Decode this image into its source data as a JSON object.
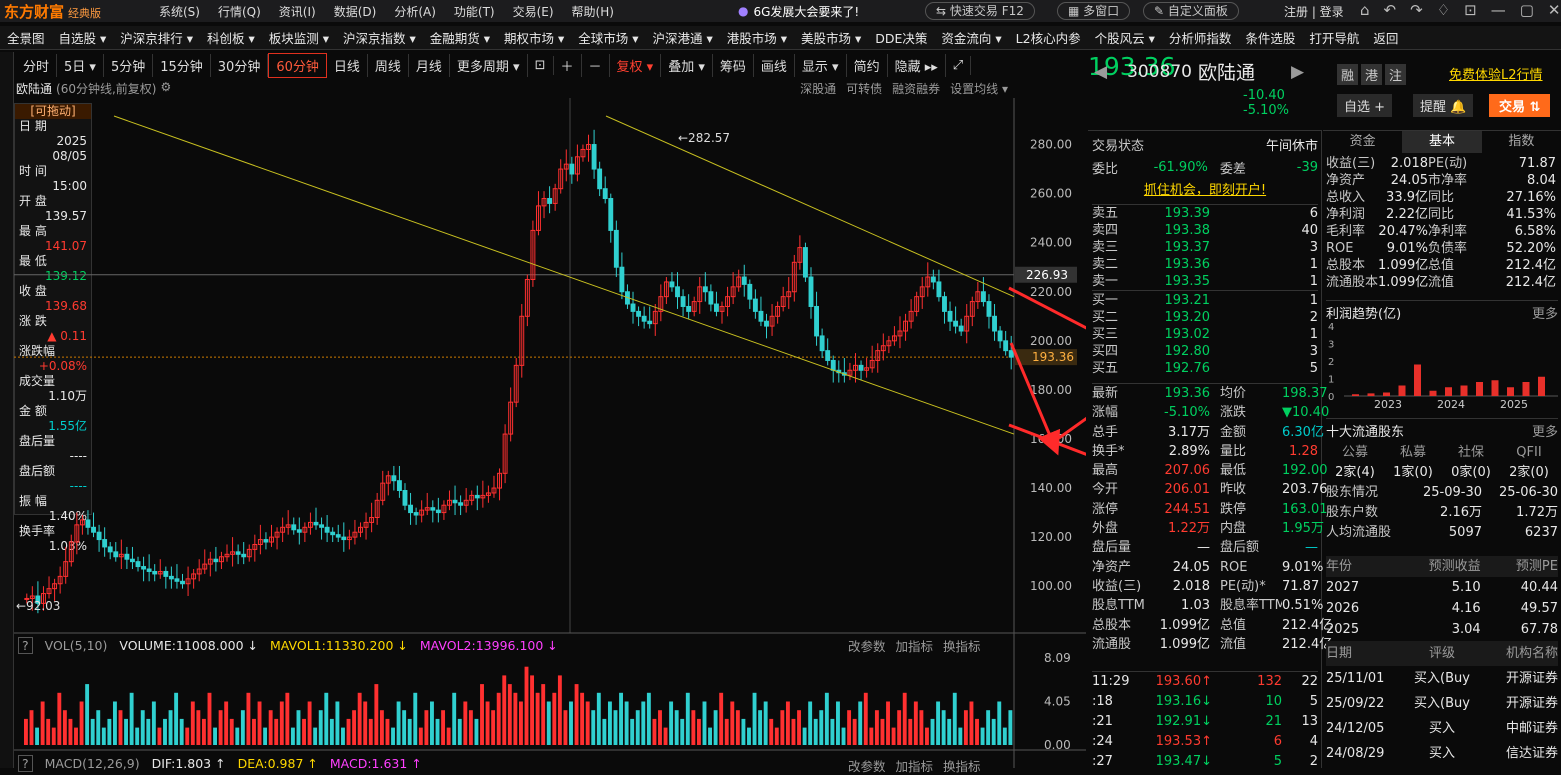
{
  "titlebar": {
    "logo": "东方财富",
    "edition": "经典版",
    "menus": [
      "系统(S)",
      "行情(Q)",
      "资讯(I)",
      "数据(D)",
      "分析(A)",
      "功能(T)",
      "交易(E)",
      "帮助(H)"
    ],
    "promo": "6G发展大会要来了!",
    "quick_trade": "快速交易 F12",
    "multi_window": "多窗口",
    "custom_panel": "自定义面板",
    "login": "注册 | 登录"
  },
  "navbar": [
    "全景图",
    "自选股 ▾",
    "沪深京排行 ▾",
    "科创板 ▾",
    "板块监测 ▾",
    "沪深京指数 ▾",
    "金融期货 ▾",
    "期权市场 ▾",
    "全球市场 ▾",
    "沪深港通 ▾",
    "港股市场 ▾",
    "美股市场 ▾",
    "DDE决策",
    "资金流向 ▾",
    "L2核心内参",
    "个股风云 ▾",
    "分析师指数",
    "条件选股",
    "打开导航",
    "返回"
  ],
  "toolbar": {
    "periods": [
      "分时",
      "5日 ▾",
      "5分钟",
      "15分钟",
      "30分钟",
      "60分钟",
      "日线",
      "周线",
      "月线",
      "更多周期 ▾"
    ],
    "selected": "60分钟",
    "adjust": "复权 ▾",
    "overlay": "叠加 ▾",
    "chips": "筹码",
    "draw": "画线",
    "display": "显示 ▾",
    "simple": "简约",
    "hide": "隐藏 ▸▸"
  },
  "subbar": {
    "title": "欧陆通",
    "info": "(60分钟线,前复权)",
    "links": [
      "深股通",
      "可转债",
      "融资融券",
      "设置均线 ▾"
    ]
  },
  "infobox": {
    "draggable": "[可拖动]",
    "date_label": "日 期",
    "date_year": "2025",
    "date_md": "08/05",
    "time_label": "时 间",
    "time": "15:00",
    "open_label": "开 盘",
    "open": "139.57",
    "high_label": "最 高",
    "high": "141.07",
    "low_label": "最 低",
    "low": "139.12",
    "close_label": "收 盘",
    "close": "139.68",
    "chg_label": "涨 跌",
    "chg": "▲ 0.11",
    "chgpct_label": "涨跌幅",
    "chgpct": "+0.08%",
    "vol_label": "成交量",
    "vol": "1.10万",
    "amt_label": "金 额",
    "amt": "1.55亿",
    "ah_vol_label": "盘后量",
    "ah_vol": "----",
    "ah_amt_label": "盘后额",
    "ah_amt": "----",
    "amp_label": "振 幅",
    "amp": "1.40%",
    "turn_label": "换手率",
    "turn": "1.03%"
  },
  "chart_data": {
    "type": "candlestick",
    "yticks": [
      "280.00",
      "260.00",
      "240.00",
      "220.00",
      "200.00",
      "180.00",
      "160.00",
      "140.00",
      "120.00",
      "100.00"
    ],
    "ylim": [
      85,
      290
    ],
    "max_label": "282.57",
    "min_label": "92.03",
    "crosshair_price": "226.93",
    "last_price": "193.36",
    "closes": [
      95,
      96,
      93,
      97,
      99,
      101,
      104,
      110,
      118,
      125,
      127,
      124,
      122,
      119,
      116,
      114,
      112,
      113,
      111,
      110,
      108,
      107,
      106,
      105,
      106,
      104,
      103,
      102,
      101,
      103,
      105,
      107,
      109,
      111,
      110,
      112,
      113,
      114,
      113,
      112,
      115,
      117,
      119,
      118,
      120,
      122,
      124,
      125,
      123,
      122,
      124,
      126,
      125,
      124,
      122,
      121,
      120,
      119,
      120,
      122,
      124,
      126,
      128,
      135,
      142,
      145,
      143,
      139,
      133,
      130,
      129,
      131,
      132,
      131,
      130,
      133,
      135,
      134,
      133,
      135,
      137,
      136,
      137,
      138,
      140,
      146,
      162,
      175,
      190,
      210,
      225,
      245,
      255,
      258,
      256,
      262,
      270,
      272,
      268,
      275,
      278,
      280,
      270,
      262,
      258,
      245,
      230,
      220,
      215,
      212,
      210,
      208,
      207,
      212,
      218,
      224,
      222,
      218,
      214,
      212,
      216,
      222,
      220,
      215,
      212,
      214,
      218,
      222,
      226,
      223,
      217,
      212,
      208,
      206,
      210,
      214,
      218,
      220,
      232,
      238,
      226,
      214,
      202,
      196,
      192,
      188,
      187,
      186,
      188,
      190,
      188,
      189,
      192,
      196,
      198,
      200,
      202,
      204,
      208,
      212,
      218,
      222,
      226,
      224,
      218,
      212,
      208,
      206,
      204,
      210,
      216,
      220,
      216,
      210,
      204,
      200,
      196,
      193.36
    ]
  },
  "volume": {
    "label": "VOL(5,10)",
    "volume": "VOLUME:11008.000 ↓",
    "ma1": "MAVOL1:11330.200 ↓",
    "ma2": "MAVOL2:13996.100 ↓",
    "ticks": [
      "8.09",
      "4.05",
      "0.00"
    ],
    "links": [
      "改参数",
      "加指标",
      "换指标"
    ],
    "bars": [
      3,
      4,
      2,
      5,
      3,
      2,
      6,
      4,
      3,
      2,
      5,
      7,
      3,
      4,
      2,
      3,
      5,
      4,
      3,
      6,
      2,
      4,
      3,
      5,
      2,
      3,
      4,
      6,
      3,
      2,
      5,
      4,
      3,
      6,
      2,
      4,
      5,
      3,
      2,
      4,
      6,
      3,
      5,
      2,
      4,
      3,
      5,
      6,
      2,
      4,
      3,
      5,
      2,
      4,
      6,
      3,
      5,
      2,
      3,
      4,
      6,
      5,
      3,
      7,
      4,
      3,
      2,
      5,
      4,
      3,
      6,
      2,
      4,
      5,
      3,
      4,
      2,
      6,
      3,
      5,
      4,
      3,
      7,
      5,
      4,
      6,
      8,
      7,
      6,
      5,
      9,
      8,
      6,
      7,
      5,
      6,
      8,
      4,
      5,
      7,
      6,
      5,
      4,
      6,
      3,
      5,
      4,
      6,
      5,
      3,
      4,
      5,
      6,
      3,
      4,
      2,
      5,
      4,
      3,
      6,
      4,
      3,
      5,
      2,
      4,
      6,
      3,
      5,
      4,
      3,
      2,
      6,
      4,
      5,
      3,
      2,
      4,
      5,
      3,
      4,
      2,
      5,
      3,
      4,
      6,
      3,
      5,
      2,
      4,
      3,
      5,
      6,
      2,
      4,
      3,
      5,
      2,
      4,
      6,
      3,
      5,
      4,
      2,
      3,
      5,
      4,
      3,
      6,
      2,
      4,
      5,
      3,
      2,
      4,
      3,
      5,
      2,
      4
    ]
  },
  "macd": {
    "label": "MACD(12,26,9)",
    "dif": "DIF:1.803 ↑",
    "dea": "DEA:0.987 ↑",
    "macd": "MACD:1.631 ↑",
    "links": [
      "改参数",
      "加指标",
      "换指标"
    ]
  },
  "stock": {
    "code": "300870",
    "name": "欧陆通",
    "price": "193.36",
    "change": "-10.40",
    "change_pct": "-5.10%",
    "tags": [
      "融",
      "港",
      "注"
    ],
    "free_l2": "免费体验L2行情",
    "watchlist": "自选 +",
    "alert": "提醒 🔔",
    "trade": "交易 ⇅"
  },
  "trade_status": {
    "label": "交易状态",
    "value": "午间休市"
  },
  "weibi": {
    "label": "委比",
    "value": "-61.90%",
    "diff_label": "委差",
    "diff": "-39"
  },
  "open_account": "抓住机会，即刻开户!",
  "asks": [
    {
      "label": "卖五",
      "price": "193.39",
      "vol": "6"
    },
    {
      "label": "卖四",
      "price": "193.38",
      "vol": "40"
    },
    {
      "label": "卖三",
      "price": "193.37",
      "vol": "3"
    },
    {
      "label": "卖二",
      "price": "193.36",
      "vol": "1"
    },
    {
      "label": "卖一",
      "price": "193.35",
      "vol": "1"
    }
  ],
  "bids": [
    {
      "label": "买一",
      "price": "193.21",
      "vol": "1"
    },
    {
      "label": "买二",
      "price": "193.20",
      "vol": "2"
    },
    {
      "label": "买三",
      "price": "193.02",
      "vol": "1"
    },
    {
      "label": "买四",
      "price": "192.80",
      "vol": "3"
    },
    {
      "label": "买五",
      "price": "192.76",
      "vol": "5"
    }
  ],
  "quote": [
    {
      "l1": "最新",
      "v1": "193.36",
      "c1": "dn",
      "l2": "均价",
      "v2": "198.37",
      "c2": "dn"
    },
    {
      "l1": "涨幅",
      "v1": "-5.10%",
      "c1": "dn",
      "l2": "涨跌",
      "v2": "▼10.40",
      "c2": "dn"
    },
    {
      "l1": "总手",
      "v1": "3.17万",
      "c1": "wt",
      "l2": "金额",
      "v2": "6.30亿",
      "c2": "cy"
    },
    {
      "l1": "换手*",
      "v1": "2.89%",
      "c1": "wt",
      "l2": "量比",
      "v2": "1.28",
      "c2": "up"
    },
    {
      "l1": "最高",
      "v1": "207.06",
      "c1": "up",
      "l2": "最低",
      "v2": "192.00",
      "c2": "dn"
    },
    {
      "l1": "今开",
      "v1": "206.01",
      "c1": "up",
      "l2": "昨收",
      "v2": "203.76",
      "c2": "wt"
    },
    {
      "l1": "涨停",
      "v1": "244.51",
      "c1": "up",
      "l2": "跌停",
      "v2": "163.01",
      "c2": "dn"
    },
    {
      "l1": "外盘",
      "v1": "1.22万",
      "c1": "up",
      "l2": "内盘",
      "v2": "1.95万",
      "c2": "dn"
    },
    {
      "l1": "盘后量",
      "v1": "—",
      "c1": "wt",
      "l2": "盘后额",
      "v2": "—",
      "c2": "cy"
    },
    {
      "l1": "净资产",
      "v1": "24.05",
      "c1": "wt",
      "l2": "ROE",
      "v2": "9.01%",
      "c2": "wt"
    },
    {
      "l1": "收益(三)",
      "v1": "2.018",
      "c1": "wt",
      "l2": "PE(动)*",
      "v2": "71.87",
      "c2": "wt"
    },
    {
      "l1": "股息TTM",
      "v1": "1.03",
      "c1": "wt",
      "l2": "股息率TTM",
      "v2": "0.51%",
      "c2": "wt"
    },
    {
      "l1": "总股本",
      "v1": "1.099亿",
      "c1": "wt",
      "l2": "总值",
      "v2": "212.4亿",
      "c2": "wt"
    },
    {
      "l1": "流通股",
      "v1": "1.099亿",
      "c1": "wt",
      "l2": "流值",
      "v2": "212.4亿",
      "c2": "wt"
    }
  ],
  "ticks": [
    {
      "t": "11:29",
      "p": "193.60↑",
      "c": "up",
      "v": "132",
      "n": "22"
    },
    {
      "t": ":18",
      "p": "193.16↓",
      "c": "dn",
      "v": "10",
      "n": "5"
    },
    {
      "t": ":21",
      "p": "192.91↓",
      "c": "dn",
      "v": "21",
      "n": "13"
    },
    {
      "t": ":24",
      "p": "193.53↑",
      "c": "up",
      "v": "6",
      "n": "4"
    },
    {
      "t": ":27",
      "p": "193.47↓",
      "c": "dn",
      "v": "5",
      "n": "2"
    }
  ],
  "tabs": [
    "资金",
    "基本",
    "指数"
  ],
  "fundamentals": [
    {
      "l1": "收益(三)",
      "v1": "2.018",
      "l2": "PE(动)",
      "v2": "71.87"
    },
    {
      "l1": "净资产",
      "v1": "24.05",
      "l2": "市净率",
      "v2": "8.04"
    },
    {
      "l1": "总收入",
      "v1": "33.9亿",
      "l2": "同比",
      "v2": "27.16%"
    },
    {
      "l1": "净利润",
      "v1": "2.22亿",
      "l2": "同比",
      "v2": "41.53%"
    },
    {
      "l1": "毛利率",
      "v1": "20.47%",
      "l2": "净利率",
      "v2": "6.58%"
    },
    {
      "l1": "ROE",
      "v1": "9.01%",
      "l2": "负债率",
      "v2": "52.20%"
    },
    {
      "l1": "总股本",
      "v1": "1.099亿",
      "l2": "总值",
      "v2": "212.4亿"
    },
    {
      "l1": "流通股本",
      "v1": "1.099亿",
      "l2": "流值",
      "v2": "212.4亿"
    }
  ],
  "profit": {
    "title": "利润趋势(亿)",
    "more": "更多",
    "yticks": [
      "4",
      "3",
      "2",
      "1",
      "0"
    ],
    "years": [
      "2023",
      "2024",
      "2025"
    ],
    "bars": [
      0.1,
      0.15,
      0.2,
      0.6,
      1.8,
      0.3,
      0.5,
      0.6,
      0.8,
      0.9,
      0.5,
      0.8,
      1.1
    ]
  },
  "holders": {
    "title": "十大流通股东",
    "more": "更多",
    "cols": [
      "公募",
      "私募",
      "社保",
      "QFII"
    ],
    "vals": [
      "2家(4)",
      "1家(0)",
      "0家(0)",
      "2家(0)"
    ],
    "info": [
      {
        "l": "股东情况",
        "a": "25-09-30",
        "b": "25-06-30"
      },
      {
        "l": "股东户数",
        "a": "2.16万",
        "b": "1.72万"
      },
      {
        "l": "人均流通股",
        "a": "5097",
        "b": "6237"
      }
    ]
  },
  "forecast": {
    "cols": [
      "年份",
      "预测收益",
      "预测PE"
    ],
    "rows": [
      [
        "2027",
        "5.10",
        "40.44"
      ],
      [
        "2026",
        "4.16",
        "49.57"
      ],
      [
        "2025",
        "3.04",
        "67.78"
      ]
    ]
  },
  "ratings": {
    "cols": [
      "日期",
      "评级",
      "机构名称"
    ],
    "rows": [
      [
        "25/11/01",
        "买入(Buy",
        "开源证券"
      ],
      [
        "25/09/22",
        "买入(Buy",
        "开源证券"
      ],
      [
        "24/12/05",
        "买入",
        "中邮证券"
      ],
      [
        "24/08/29",
        "买入",
        "信达证券"
      ]
    ]
  }
}
